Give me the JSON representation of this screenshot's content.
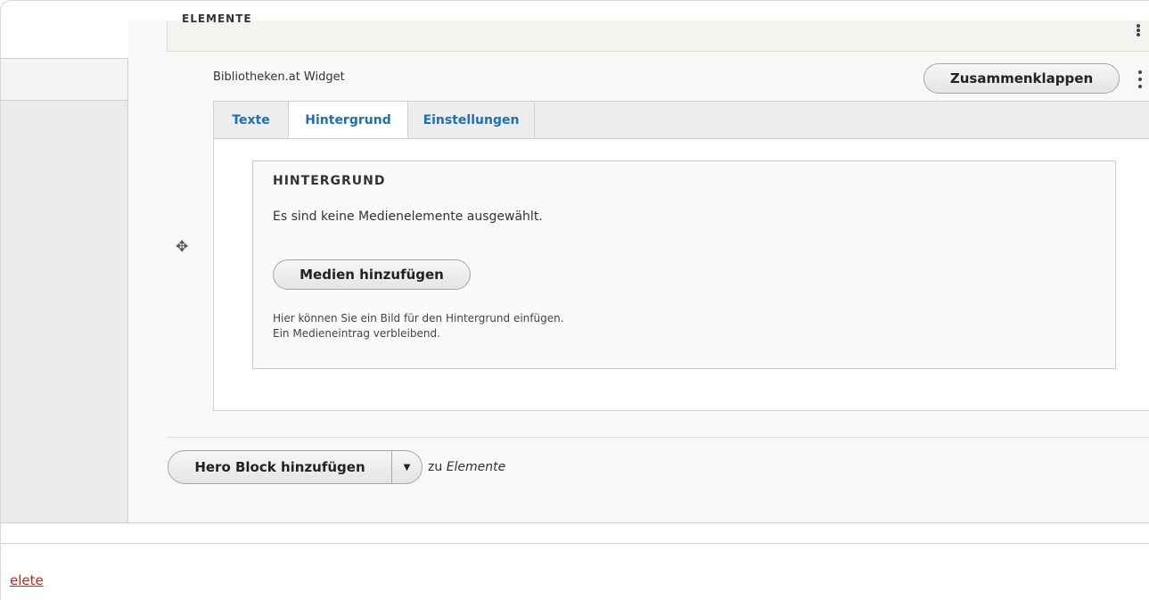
{
  "elements_header": {
    "label": "ELEMENTE"
  },
  "widget": {
    "title": "Bibliotheken.at Widget",
    "collapse_label": "Zusammenklappen"
  },
  "tabs": [
    {
      "label": "Texte",
      "active": false
    },
    {
      "label": "Hintergrund",
      "active": true
    },
    {
      "label": "Einstellungen",
      "active": false
    }
  ],
  "background_field": {
    "legend": "HINTERGRUND",
    "empty_message": "Es sind keine Medienelemente ausgewählt.",
    "add_media_label": "Medien hinzufügen",
    "help_line1": "Hier können Sie ein Bild für den Hintergrund einfügen.",
    "help_line2": "Ein Medieneintrag verbleibend."
  },
  "add_block": {
    "button_label": "Hero Block hinzufügen",
    "suffix_prefix": "zu",
    "suffix_target": "Elemente"
  },
  "footer": {
    "delete_label": "elete"
  },
  "colors": {
    "tab_link": "#1f6fb5",
    "delete_link": "#c7261f"
  }
}
